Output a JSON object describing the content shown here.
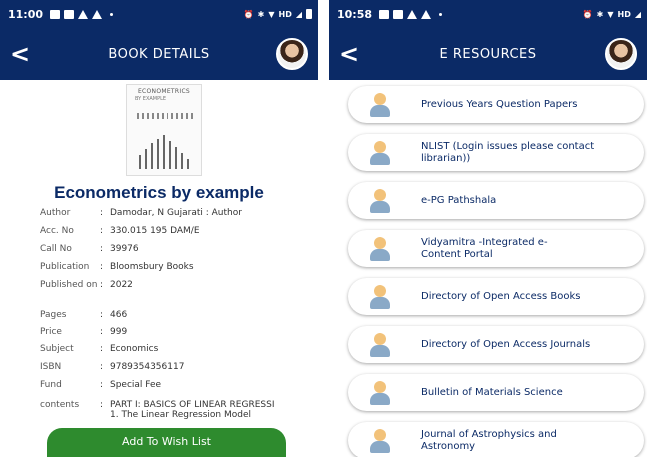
{
  "left": {
    "status_time": "11:00",
    "status_network": "HD",
    "title": "BOOK DETAILS",
    "cover": {
      "title": "ECONOMETRICS",
      "subtitle": "BY EXAMPLE"
    },
    "book_title": "Econometrics by example",
    "details": [
      {
        "label": "Author",
        "value": "Damodar, N Gujarati : Author"
      },
      {
        "label": "Acc. No",
        "value": "330.015 195 DAM/E"
      },
      {
        "label": "Call No",
        "value": "39976"
      },
      {
        "label": "Publication",
        "value": "Bloomsbury Books"
      },
      {
        "label": "Published on",
        "value": "2022"
      },
      {
        "label": "Pages",
        "value": "466"
      },
      {
        "label": "Price",
        "value": "999"
      },
      {
        "label": "Subject",
        "value": "Economics"
      },
      {
        "label": "ISBN",
        "value": "9789354356117"
      },
      {
        "label": "Fund",
        "value": "Special Fee"
      },
      {
        "label": "contents",
        "value": "PART I: BASICS OF LINEAR REGRESSI",
        "value2": "1. The Linear Regression Model"
      }
    ],
    "wishlist_button": "Add To Wish List"
  },
  "right": {
    "status_time": "10:58",
    "status_network": "HD",
    "title": "E RESOURCES",
    "items": [
      {
        "label": "Previous Years Question Papers"
      },
      {
        "label": "NLIST (Login issues please contact librarian))"
      },
      {
        "label": "e-PG Pathshala"
      },
      {
        "label": "Vidyamitra -Integrated e-Content Portal"
      },
      {
        "label": "Directory of Open Access Books"
      },
      {
        "label": "Directory of Open Access Journals"
      },
      {
        "label": "Bulletin of Materials Science"
      },
      {
        "label": "Journal of Astrophysics and Astronomy"
      }
    ]
  },
  "colors": {
    "primary": "#0b2a66",
    "button_green": "#2e8b2e"
  },
  "icons": {
    "back": "chevron-left-icon",
    "profile": "avatar",
    "resource": "person-icon"
  }
}
